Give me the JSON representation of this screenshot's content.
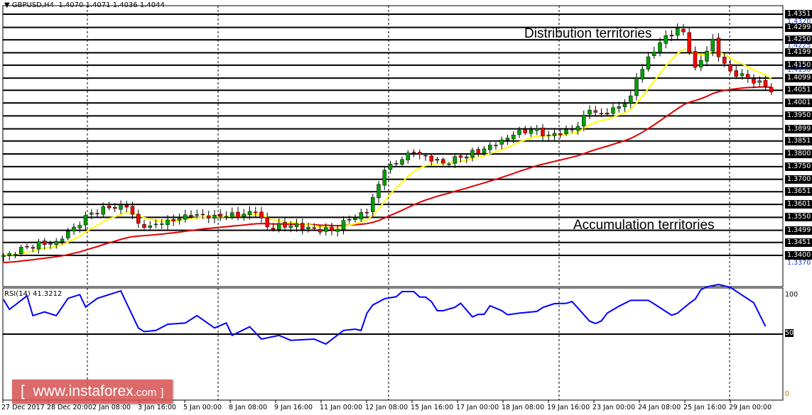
{
  "header": {
    "symbol": "GBPUSD,H4",
    "open": "1.4070",
    "high": "1.4071",
    "low": "1.4036",
    "close": "1.4044"
  },
  "rsi_header": {
    "label": "RSI(14)",
    "value": "41.3212"
  },
  "annotations": {
    "distribution": "Distribution territories",
    "accumulation": "Accumulation territories"
  },
  "logo": {
    "text": "www.instaforex",
    "suffix": ".com",
    "open_bracket": "[",
    "close_bracket": "]"
  },
  "colors": {
    "up": "#00a000",
    "down": "#ff0000",
    "fast_ma": "#ffff00",
    "slow_ma": "#e00000",
    "rsi": "#0000ff",
    "logo_bg": "#d65050"
  },
  "chart_data": [
    {
      "type": "candlestick",
      "title": "GBPUSD,H4",
      "ylim": [
        1.337,
        1.4351
      ],
      "price_levels_major": [
        "1.4351",
        "1.4299",
        "1.4250",
        "1.4199",
        "1.4150",
        "1.4099",
        "1.4051",
        "1.4001",
        "1.3950",
        "1.3899",
        "1.3851",
        "1.3800",
        "1.3750",
        "1.3700",
        "1.3651",
        "1.3601",
        "1.3550",
        "1.3499",
        "1.3451",
        "1.3400"
      ],
      "price_levels_minor": [
        "1.4320",
        "1.4225",
        "1.4130",
        "1.3370"
      ],
      "time_labels": [
        "27 Dec 2017",
        "28 Dec 20:00",
        "2 Jan 08:00",
        "3 Jan 16:00",
        "5 Jan 00:00",
        "8 Jan 08:00",
        "9 Jan 16:00",
        "11 Jan 00:00",
        "12 Jan 08:00",
        "15 Jan 16:00",
        "17 Jan 00:00",
        "18 Jan 08:00",
        "19 Jan 16:00",
        "23 Jan 00:00",
        "24 Jan 08:00",
        "25 Jan 16:00",
        "29 Jan 00:00"
      ],
      "bars": 132,
      "close_keypoints": [
        [
          0,
          1.34
        ],
        [
          1,
          1.3408
        ],
        [
          4,
          1.3434
        ],
        [
          9,
          1.3456
        ],
        [
          12,
          1.3512
        ],
        [
          15,
          1.3568
        ],
        [
          18,
          1.3587
        ],
        [
          21,
          1.359
        ],
        [
          23,
          1.3526
        ],
        [
          25,
          1.3517
        ],
        [
          28,
          1.354
        ],
        [
          32,
          1.3554
        ],
        [
          36,
          1.3559
        ],
        [
          38,
          1.3554
        ],
        [
          43,
          1.3568
        ],
        [
          45,
          1.3512
        ],
        [
          49,
          1.3517
        ],
        [
          53,
          1.3506
        ],
        [
          56,
          1.3498
        ],
        [
          59,
          1.354
        ],
        [
          62,
          1.3568
        ],
        [
          64,
          1.368
        ],
        [
          65,
          1.3736
        ],
        [
          68,
          1.3778
        ],
        [
          70,
          1.3806
        ],
        [
          72,
          1.3792
        ],
        [
          75,
          1.3764
        ],
        [
          78,
          1.3786
        ],
        [
          82,
          1.382
        ],
        [
          84,
          1.3834
        ],
        [
          87,
          1.3875
        ],
        [
          90,
          1.3895
        ],
        [
          93,
          1.3875
        ],
        [
          95,
          1.3875
        ],
        [
          98,
          1.3909
        ],
        [
          100,
          1.3973
        ],
        [
          102,
          1.3959
        ],
        [
          105,
          1.3987
        ],
        [
          107,
          1.4029
        ],
        [
          108,
          1.4099
        ],
        [
          110,
          1.4183
        ],
        [
          112,
          1.4239
        ],
        [
          115,
          1.4295
        ],
        [
          116,
          1.4281
        ],
        [
          118,
          1.4141
        ],
        [
          119,
          1.4169
        ],
        [
          121,
          1.4253
        ],
        [
          122,
          1.4183
        ],
        [
          124,
          1.4127
        ],
        [
          127,
          1.4099
        ],
        [
          130,
          1.4066
        ],
        [
          131,
          1.4044
        ]
      ],
      "series": [
        {
          "name": "fast MA",
          "color": "#ffff00"
        },
        {
          "name": "slow MA",
          "color": "#e00000"
        }
      ]
    },
    {
      "type": "line",
      "title": "RSI(14) 41.3212",
      "ylim": [
        0,
        100
      ],
      "levels": [
        "100",
        "50",
        "0"
      ],
      "points": [
        [
          0,
          78
        ],
        [
          1,
          70
        ],
        [
          4,
          81
        ],
        [
          5,
          65
        ],
        [
          7,
          68
        ],
        [
          9,
          65
        ],
        [
          11,
          79
        ],
        [
          13,
          82
        ],
        [
          14,
          72
        ],
        [
          16,
          79
        ],
        [
          20,
          85
        ],
        [
          23,
          55
        ],
        [
          24,
          52
        ],
        [
          26,
          53
        ],
        [
          28,
          58
        ],
        [
          31,
          59
        ],
        [
          33,
          65
        ],
        [
          36,
          55
        ],
        [
          38,
          59
        ],
        [
          39,
          49
        ],
        [
          42,
          56
        ],
        [
          44,
          46
        ],
        [
          47,
          49
        ],
        [
          49,
          45
        ],
        [
          53,
          46
        ],
        [
          55,
          42
        ],
        [
          58,
          53
        ],
        [
          60,
          54
        ],
        [
          61,
          53
        ],
        [
          62,
          67
        ],
        [
          63,
          73.6
        ],
        [
          65,
          78.7
        ],
        [
          67,
          80.3
        ],
        [
          68,
          84.5
        ],
        [
          70,
          84.5
        ],
        [
          71,
          80
        ],
        [
          72,
          80
        ],
        [
          73,
          76.4
        ],
        [
          74,
          69
        ],
        [
          75,
          69
        ],
        [
          77,
          71.7
        ],
        [
          78,
          75
        ],
        [
          80,
          64
        ],
        [
          81,
          66
        ],
        [
          82,
          66
        ],
        [
          83,
          73
        ],
        [
          85,
          69
        ],
        [
          86,
          65.7
        ],
        [
          88,
          67
        ],
        [
          91,
          68.4
        ],
        [
          92,
          71.6
        ],
        [
          94,
          74.7
        ],
        [
          96,
          74.9
        ],
        [
          97,
          76.4
        ],
        [
          100,
          60.5
        ],
        [
          101,
          58.6
        ],
        [
          102,
          60.7
        ],
        [
          103,
          67
        ],
        [
          105,
          72.6
        ],
        [
          107,
          77.4
        ],
        [
          110,
          77.4
        ],
        [
          111,
          74.5
        ],
        [
          114,
          65.3
        ],
        [
          115,
          67
        ],
        [
          116,
          71
        ],
        [
          117,
          74.9
        ],
        [
          118,
          78.3
        ],
        [
          119,
          86
        ],
        [
          120,
          88.3
        ],
        [
          122,
          90.2
        ],
        [
          124,
          87.9
        ],
        [
          128,
          75.4
        ],
        [
          130,
          56.3
        ]
      ]
    }
  ]
}
